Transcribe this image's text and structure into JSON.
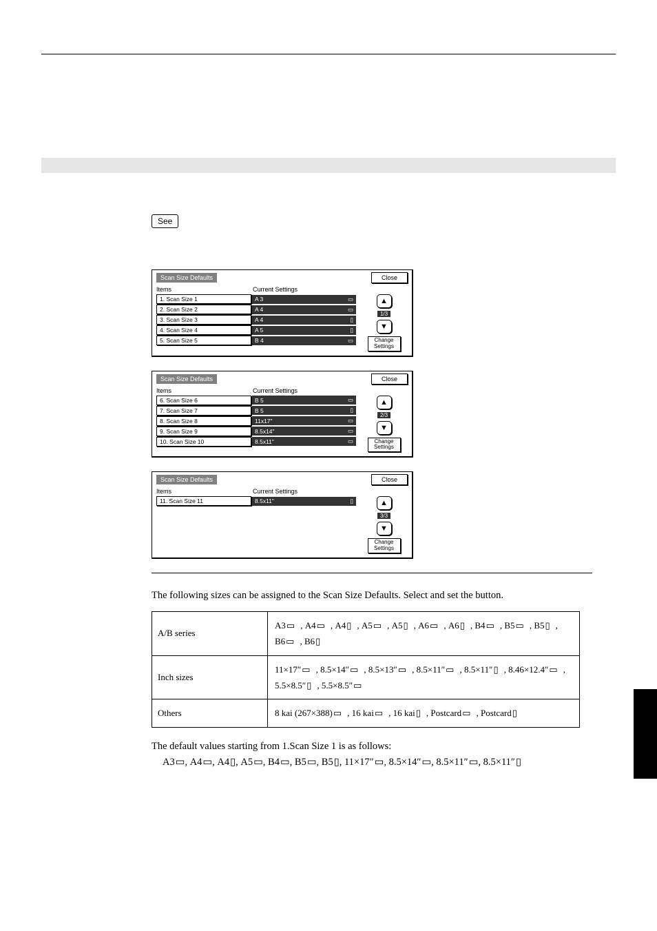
{
  "see_label": "See",
  "panel_title": "Scan Size Defaults",
  "close_label": "Close",
  "col_items": "Items",
  "col_settings": "Current Settings",
  "change_l1": "Change",
  "change_l2": "Settings",
  "panels": [
    {
      "page": "1/3",
      "rows": [
        {
          "item": "1. Scan Size 1",
          "value": "A 3",
          "orient": "land"
        },
        {
          "item": "2. Scan Size 2",
          "value": "A 4",
          "orient": "land"
        },
        {
          "item": "3. Scan Size 3",
          "value": "A 4",
          "orient": "port"
        },
        {
          "item": "4. Scan Size 4",
          "value": "A 5",
          "orient": "port"
        },
        {
          "item": "5. Scan Size 5",
          "value": "B 4",
          "orient": "land"
        }
      ]
    },
    {
      "page": "2/3",
      "rows": [
        {
          "item": "6. Scan Size 6",
          "value": "B 5",
          "orient": "land"
        },
        {
          "item": "7. Scan Size 7",
          "value": "B 5",
          "orient": "port"
        },
        {
          "item": "8. Scan Size 8",
          "value": "11x17\"",
          "orient": "land"
        },
        {
          "item": "9. Scan Size 9",
          "value": "8.5x14\"",
          "orient": "land"
        },
        {
          "item": "10. Scan Size 10",
          "value": "8.5x11\"",
          "orient": "land"
        }
      ]
    },
    {
      "page": "3/3",
      "rows": [
        {
          "item": "11. Scan Size 11",
          "value": "8.5x11\"",
          "orient": "port"
        }
      ]
    }
  ],
  "note_assignable": "The following sizes can be assigned to the Scan Size Defaults. Select and set the button.",
  "table": {
    "rows": [
      {
        "label": "A/B series",
        "sizes": [
          {
            "t": "A3",
            "o": "land"
          },
          {
            "t": "A4",
            "o": "land"
          },
          {
            "t": "A4",
            "o": "port"
          },
          {
            "t": "A5",
            "o": "land"
          },
          {
            "t": "A5",
            "o": "port"
          },
          {
            "t": "A6",
            "o": "land"
          },
          {
            "t": "A6",
            "o": "port"
          },
          {
            "t": "B4",
            "o": "land"
          },
          {
            "t": "B5",
            "o": "land"
          },
          {
            "t": "B5",
            "o": "port"
          },
          {
            "t": "B6",
            "o": "land"
          },
          {
            "t": "B6",
            "o": "port"
          }
        ]
      },
      {
        "label": "Inch sizes",
        "sizes": [
          {
            "t": "11×17″",
            "o": "land"
          },
          {
            "t": "8.5×14″",
            "o": "land"
          },
          {
            "t": "8.5×13″",
            "o": "land"
          },
          {
            "t": "8.5×11″",
            "o": "land"
          },
          {
            "t": "8.5×11″",
            "o": "port"
          },
          {
            "t": "8.46×12.4″",
            "o": "land"
          },
          {
            "t": "5.5×8.5″",
            "o": "port"
          },
          {
            "t": "5.5×8.5″",
            "o": "land"
          }
        ]
      },
      {
        "label": "Others",
        "sizes": [
          {
            "t": "8 kai (267×388)",
            "o": "land"
          },
          {
            "t": "16 kai",
            "o": "land"
          },
          {
            "t": "16 kai",
            "o": "port"
          },
          {
            "t": "Postcard",
            "o": "land"
          },
          {
            "t": "Postcard",
            "o": "port"
          }
        ]
      }
    ]
  },
  "defaults_intro": "The default values starting from 1.Scan Size 1 is as follows:",
  "defaults_list": [
    {
      "t": "A3",
      "o": "land"
    },
    {
      "t": "A4",
      "o": "land"
    },
    {
      "t": "A4",
      "o": "port"
    },
    {
      "t": "A5",
      "o": "land"
    },
    {
      "t": "B4",
      "o": "land"
    },
    {
      "t": "B5",
      "o": "land"
    },
    {
      "t": "B5",
      "o": "port"
    },
    {
      "t": "11×17″",
      "o": "land"
    },
    {
      "t": "8.5×14″",
      "o": "land"
    },
    {
      "t": "8.5×11″",
      "o": "land"
    },
    {
      "t": "8.5×11″",
      "o": "port"
    }
  ]
}
